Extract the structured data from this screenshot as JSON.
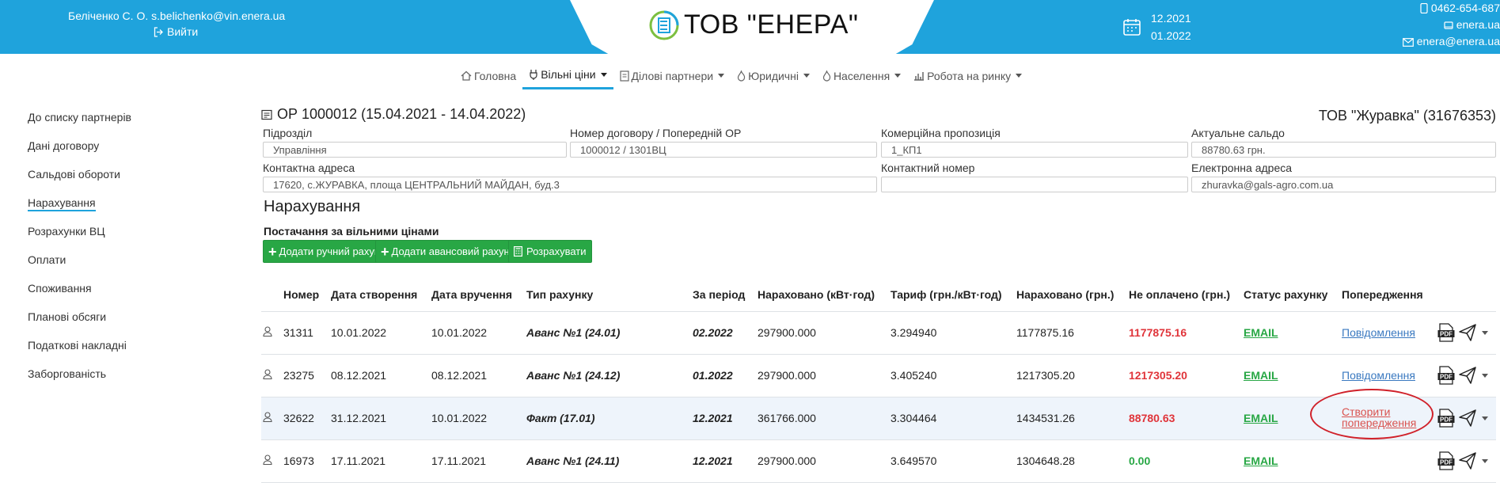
{
  "header": {
    "user_name": "Беліченко С. О. s.belichenko@vin.enera.ua",
    "logout_label": "Вийти",
    "logo_title": "ТОВ \"ЕНЕРА\"",
    "period_from": "12.2021",
    "period_to": "01.2022",
    "phone": "0462-654-687",
    "site": "enera.ua",
    "email": "enera@enera.ua"
  },
  "nav": {
    "items": [
      {
        "label": "Головна",
        "icon": "home-icon",
        "dropdown": false
      },
      {
        "label": "Вільні ціни",
        "icon": "plug-icon",
        "dropdown": true,
        "active": true
      },
      {
        "label": "Ділові партнери",
        "icon": "address-book-icon",
        "dropdown": true
      },
      {
        "label": "Юридичні",
        "icon": "flame-icon",
        "dropdown": true
      },
      {
        "label": "Населення",
        "icon": "flame-icon",
        "dropdown": true
      },
      {
        "label": "Робота на ринку",
        "icon": "chart-icon",
        "dropdown": true
      }
    ]
  },
  "sidebar": {
    "items": [
      {
        "label": "До списку партнерів"
      },
      {
        "label": "Дані договору"
      },
      {
        "label": "Сальдові обороти"
      },
      {
        "label": "Нарахування",
        "active": true
      },
      {
        "label": "Розрахунки ВЦ"
      },
      {
        "label": "Оплати"
      },
      {
        "label": "Споживання"
      },
      {
        "label": "Планові обсяги"
      },
      {
        "label": "Податкові накладні"
      },
      {
        "label": "Заборгованість"
      }
    ]
  },
  "contract": {
    "title": "ОР 1000012 (15.04.2021 - 14.04.2022)",
    "company": "ТОВ \"Журавка\" (31676353)",
    "fields": {
      "department_label": "Підрозділ",
      "department_value": "Управління",
      "contract_label": "Номер договору / Попередній ОР",
      "contract_value": "1000012 / 1301ВЦ",
      "offer_label": "Комерційна пропозиція",
      "offer_value": "1_КП1",
      "balance_label": "Актуальне сальдо",
      "balance_value": "88780.63 грн.",
      "address_label": "Контактна адреса",
      "address_value": "17620, с.ЖУРАВКА, площа ЦЕНТРАЛЬНИЙ МАЙДАН, буд.3",
      "phone_label": "Контактний номер",
      "phone_value": "",
      "email_label": "Електронна адреса",
      "email_value": "zhuravka@gals-agro.com.ua"
    }
  },
  "section": {
    "title": "Нарахування",
    "subtitle": "Постачання за вільними цінами",
    "btn_manual": "Додати ручний рахунок",
    "btn_advance": "Додати авансовий рахунок",
    "btn_calc": "Розрахувати"
  },
  "table": {
    "headers": {
      "number": "Номер",
      "created": "Дата створення",
      "delivered": "Дата вручення",
      "type": "Тип рахунку",
      "period": "За період",
      "kwh": "Нараховано (кВт·год)",
      "tariff": "Тариф (грн./кВт·год)",
      "uah": "Нараховано (грн.)",
      "unpaid": "Не оплачено (грн.)",
      "status": "Статус рахунку",
      "warning": "Попередження"
    },
    "rows": [
      {
        "number": "31311",
        "created": "10.01.2022",
        "delivered": "10.01.2022",
        "type": "Аванс №1 (24.01)",
        "period": "02.2022",
        "kwh": "297900.000",
        "tariff": "3.294940",
        "uah": "1177875.16",
        "unpaid": "1177875.16",
        "status": "EMAIL",
        "warning": "Повідомлення"
      },
      {
        "number": "23275",
        "created": "08.12.2021",
        "delivered": "08.12.2021",
        "type": "Аванс №1 (24.12)",
        "period": "01.2022",
        "kwh": "297900.000",
        "tariff": "3.405240",
        "uah": "1217305.20",
        "unpaid": "1217305.20",
        "status": "EMAIL",
        "warning": "Повідомлення"
      },
      {
        "number": "32622",
        "created": "31.12.2021",
        "delivered": "10.01.2022",
        "type": "Факт (17.01)",
        "period": "12.2021",
        "kwh": "361766.000",
        "tariff": "3.304464",
        "uah": "1434531.26",
        "unpaid": "88780.63",
        "status": "EMAIL",
        "warning_line1": "Створити",
        "warning_line2": "попередження"
      },
      {
        "number": "16973",
        "created": "17.11.2021",
        "delivered": "17.11.2021",
        "type": "Аванс №1 (24.11)",
        "period": "12.2021",
        "kwh": "297900.000",
        "tariff": "3.649570",
        "uah": "1304648.28",
        "unpaid": "0.00",
        "status": "EMAIL",
        "warning": ""
      }
    ]
  },
  "colors": {
    "brand_blue": "#1fa3dc",
    "button_green": "#28a745",
    "debt_red": "#e0343a",
    "link_blue": "#3a79c0",
    "annotation_red": "#d0212a"
  }
}
